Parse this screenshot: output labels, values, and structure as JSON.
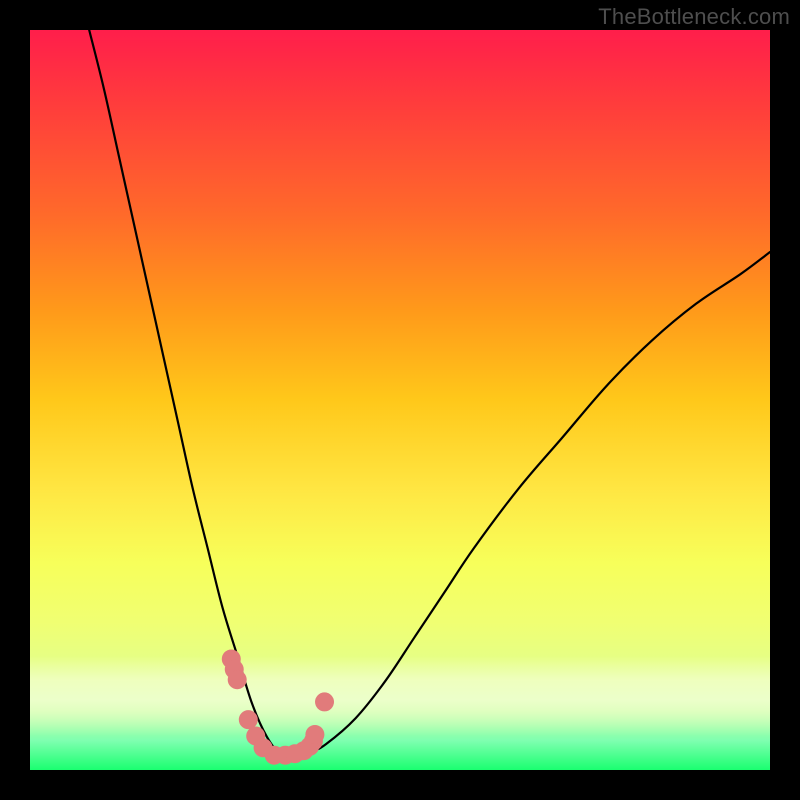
{
  "watermark": "TheBottleneck.com",
  "colors": {
    "frame": "#000000",
    "marker": "#e17b7b",
    "curve": "#000000",
    "gradient_top": "#ff1e4b",
    "gradient_bottom": "#1aff70"
  },
  "chart_data": {
    "type": "line",
    "title": "",
    "xlabel": "",
    "ylabel": "",
    "xlim": [
      0,
      100
    ],
    "ylim": [
      0,
      100
    ],
    "description": "Bottleneck curve: a sharp V-shaped curve whose minimum (no bottleneck) sits near x≈34 at the bottom; both arms rise steeply toward the top. Green region at bottom = good, red at top = severe bottleneck.",
    "series": [
      {
        "name": "bottleneck-curve",
        "x": [
          8,
          10,
          12,
          14,
          16,
          18,
          20,
          22,
          24,
          26,
          28,
          30,
          32,
          34,
          36,
          38,
          40,
          44,
          48,
          52,
          56,
          60,
          66,
          72,
          78,
          84,
          90,
          96,
          100
        ],
        "y": [
          100,
          92,
          83,
          74,
          65,
          56,
          47,
          38,
          30,
          22,
          15.5,
          9,
          4.5,
          2,
          2,
          2.5,
          3.5,
          7,
          12,
          18,
          24,
          30,
          38,
          45,
          52,
          58,
          63,
          67,
          70
        ]
      }
    ],
    "markers": {
      "name": "highlighted-points",
      "comment": "Pink dot cluster near the minimum of the curve",
      "x": [
        27.2,
        27.6,
        28.0,
        29.5,
        30.5,
        31.5,
        33.0,
        34.5,
        35.8,
        37.0,
        37.8,
        38.3,
        38.5,
        39.8
      ],
      "y": [
        15.0,
        13.6,
        12.2,
        6.8,
        4.6,
        3.0,
        2.0,
        2.0,
        2.2,
        2.6,
        3.2,
        3.9,
        4.8,
        9.2
      ]
    }
  }
}
